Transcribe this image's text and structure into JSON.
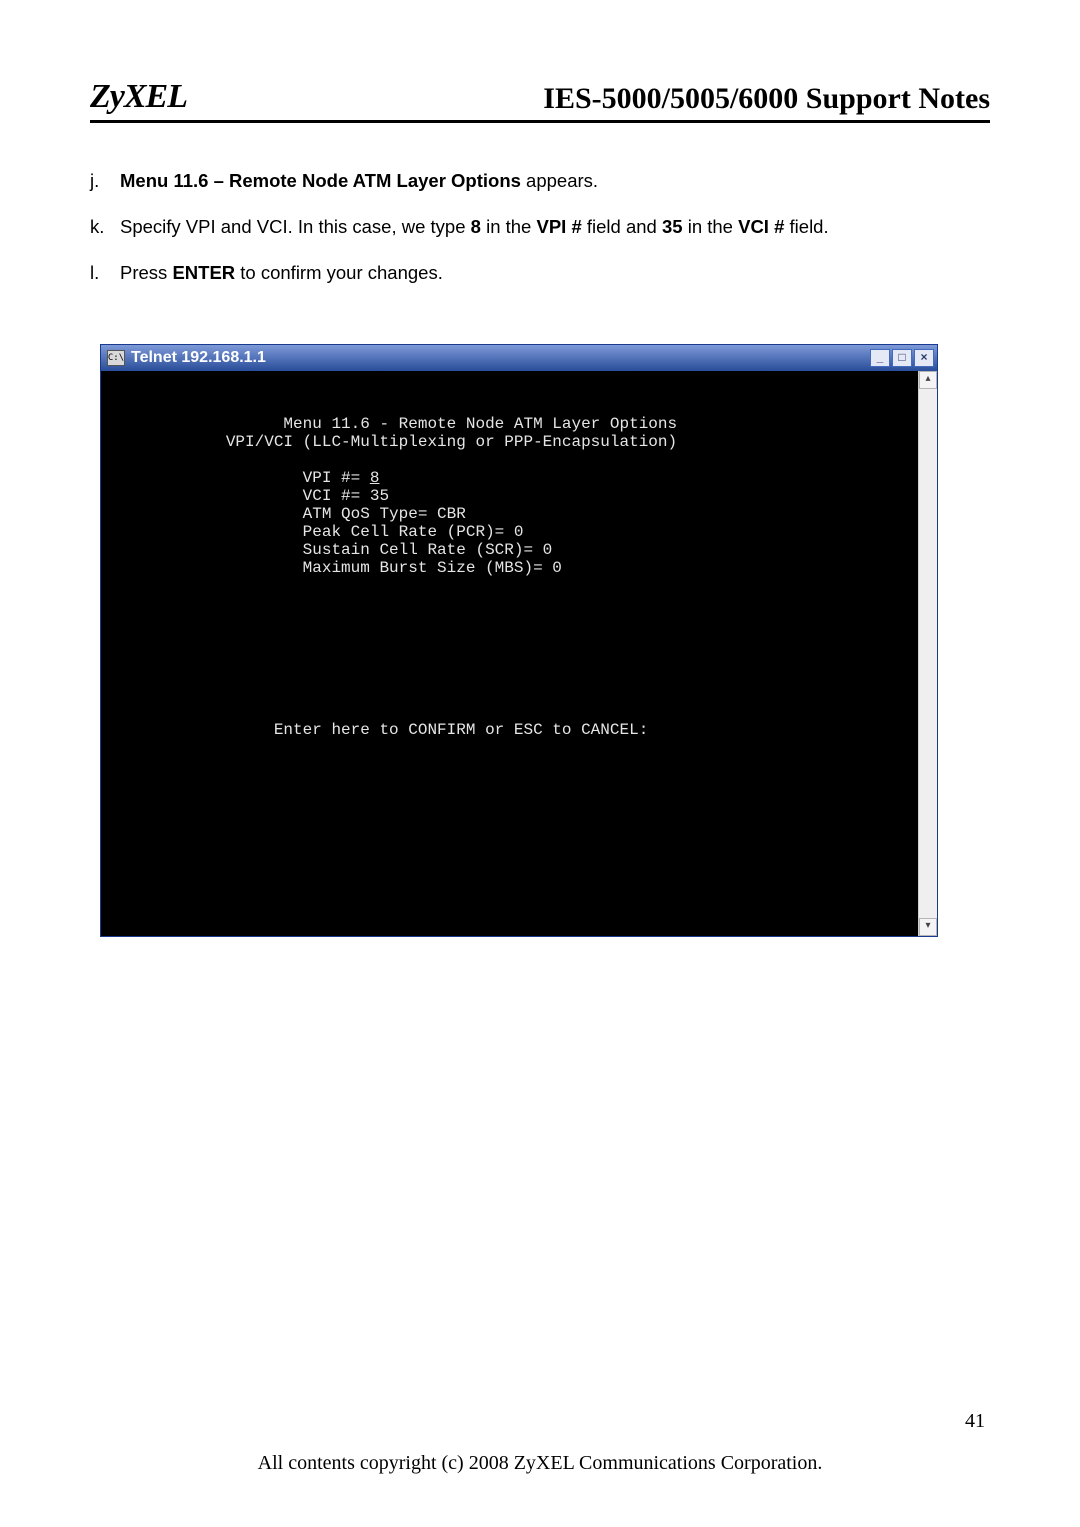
{
  "header": {
    "brand": "ZyXEL",
    "doc_title": "IES-5000/5005/6000 Support Notes"
  },
  "steps": {
    "j": {
      "letter": "j.",
      "bold": "Menu 11.6 – Remote Node ATM Layer Options",
      "tail": " appears."
    },
    "k": {
      "letter": "k.",
      "pre": "Specify VPI and VCI. In this case, we type ",
      "b1": "8",
      "mid1": " in the ",
      "b2": "VPI #",
      "mid2": " field and ",
      "b3": "35",
      "mid3": " in the ",
      "b4": "VCI #",
      "tail": " field."
    },
    "l": {
      "letter": "l.",
      "pre": "Press ",
      "b1": "ENTER",
      "tail": " to confirm your changes."
    }
  },
  "telnet": {
    "icon_label": "C:\\",
    "title": "Telnet 192.168.1.1",
    "controls": {
      "min": "_",
      "max": "□",
      "close": "×"
    },
    "scroll": {
      "up": "▴",
      "down": "▾"
    },
    "menu_title": "                   Menu 11.6 - Remote Node ATM Layer Options",
    "menu_sub": "             VPI/VCI (LLC-Multiplexing or PPP-Encapsulation)",
    "vpi_label": "                     VPI #= ",
    "vpi_value": "8",
    "vci": "                     VCI #= 35",
    "qos": "                     ATM QoS Type= CBR",
    "pcr": "                     Peak Cell Rate (PCR)= 0",
    "scr": "                     Sustain Cell Rate (SCR)= 0",
    "mbs": "                     Maximum Burst Size (MBS)= 0",
    "confirm": "                  Enter here to CONFIRM or ESC to CANCEL:"
  },
  "footer": {
    "page_number": "41",
    "copyright": "All contents copyright (c) 2008 ZyXEL Communications Corporation."
  },
  "chart_data": {
    "type": "table",
    "title": "Menu 11.6 - Remote Node ATM Layer Options",
    "subtitle": "VPI/VCI (LLC-Multiplexing or PPP-Encapsulation)",
    "fields": [
      {
        "name": "VPI #",
        "value": 8
      },
      {
        "name": "VCI #",
        "value": 35
      },
      {
        "name": "ATM QoS Type",
        "value": "CBR"
      },
      {
        "name": "Peak Cell Rate (PCR)",
        "value": 0
      },
      {
        "name": "Sustain Cell Rate (SCR)",
        "value": 0
      },
      {
        "name": "Maximum Burst Size (MBS)",
        "value": 0
      }
    ],
    "prompt": "Enter here to CONFIRM or ESC to CANCEL:"
  }
}
